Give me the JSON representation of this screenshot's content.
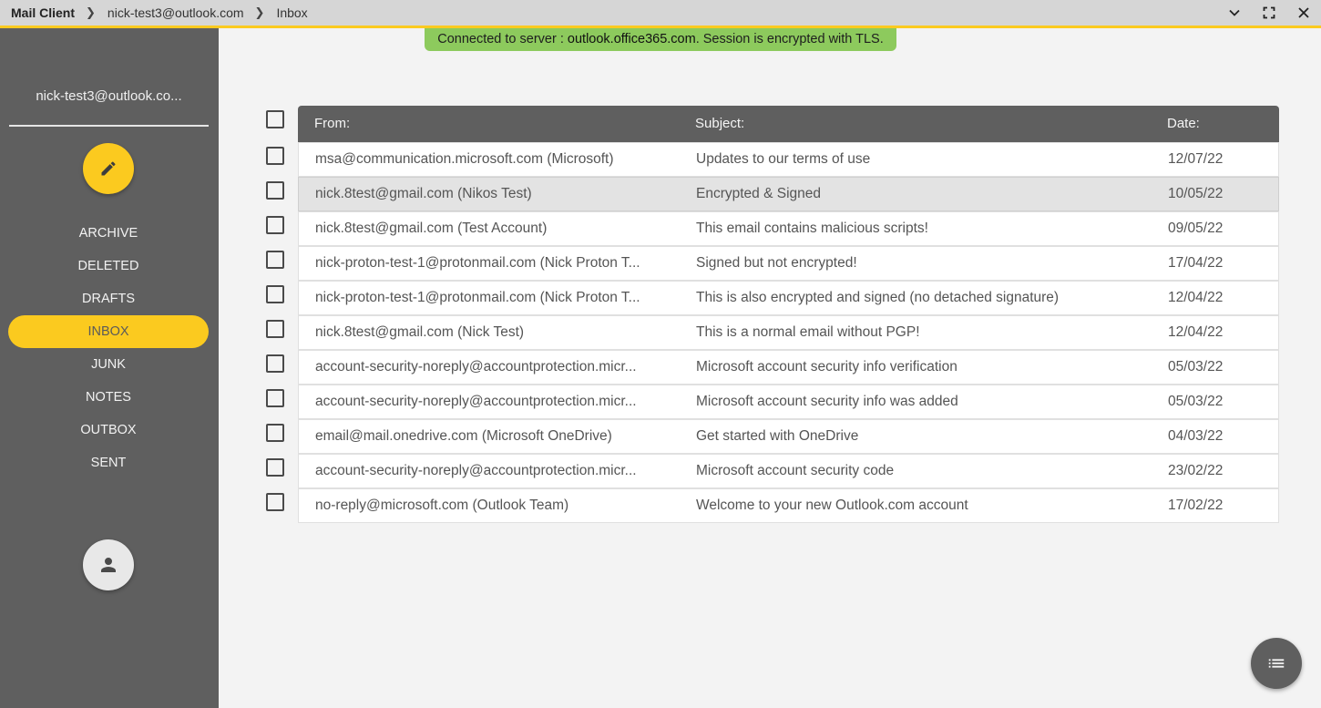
{
  "breadcrumb": {
    "app": "Mail Client",
    "account": "nick-test3@outlook.com",
    "folder": "Inbox"
  },
  "status": {
    "prefix": "Connected to server : ",
    "server": "outlook.office365.com",
    "suffix": ". Session is encrypted with TLS."
  },
  "sidebar": {
    "account": "nick-test3@outlook.co...",
    "folders": [
      {
        "label": "ARCHIVE"
      },
      {
        "label": "DELETED"
      },
      {
        "label": "DRAFTS"
      },
      {
        "label": "INBOX"
      },
      {
        "label": "JUNK"
      },
      {
        "label": "NOTES"
      },
      {
        "label": "OUTBOX"
      },
      {
        "label": "SENT"
      }
    ]
  },
  "table": {
    "headers": {
      "from": "From:",
      "subject": "Subject:",
      "date": "Date:"
    },
    "rows": [
      {
        "from": "msa@communication.microsoft.com (Microsoft)",
        "subject": "Updates to our terms of use",
        "date": "12/07/22"
      },
      {
        "from": "nick.8test@gmail.com (Nikos Test)",
        "subject": "Encrypted & Signed",
        "date": "10/05/22"
      },
      {
        "from": "nick.8test@gmail.com (Test Account)",
        "subject": "This email contains malicious scripts!",
        "date": "09/05/22"
      },
      {
        "from": "nick-proton-test-1@protonmail.com (Nick Proton T...",
        "subject": "Signed but not encrypted!",
        "date": "17/04/22"
      },
      {
        "from": "nick-proton-test-1@protonmail.com (Nick Proton T...",
        "subject": "This is also encrypted and signed (no detached signature)",
        "date": "12/04/22"
      },
      {
        "from": "nick.8test@gmail.com (Nick Test)",
        "subject": "This is a normal email without PGP!",
        "date": "12/04/22"
      },
      {
        "from": "account-security-noreply@accountprotection.micr...",
        "subject": "Microsoft account security info verification",
        "date": "05/03/22"
      },
      {
        "from": "account-security-noreply@accountprotection.micr...",
        "subject": "Microsoft account security info was added",
        "date": "05/03/22"
      },
      {
        "from": "email@mail.onedrive.com (Microsoft OneDrive)",
        "subject": "Get started with OneDrive",
        "date": "04/03/22"
      },
      {
        "from": "account-security-noreply@accountprotection.micr...",
        "subject": "Microsoft account security code",
        "date": "23/02/22"
      },
      {
        "from": "no-reply@microsoft.com (Outlook Team)",
        "subject": "Welcome to your new Outlook.com account",
        "date": "17/02/22"
      }
    ]
  },
  "colors": {
    "accent": "#fbca1f",
    "sidebar": "#5f5f5f",
    "status": "#8dca5d"
  },
  "icons": {
    "compose": "pencil-icon",
    "profile": "person-icon",
    "fab": "list-icon"
  }
}
